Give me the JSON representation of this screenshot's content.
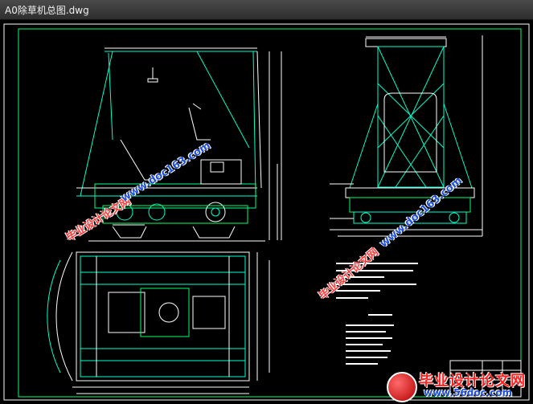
{
  "window": {
    "title": "A0除草机总图.dwg"
  },
  "watermarks": [
    {
      "text": "毕业设计论文网",
      "color": "red"
    },
    {
      "text": "www.doc163.com",
      "color": "blue"
    },
    {
      "text": "毕业设计论文网",
      "color": "red"
    },
    {
      "text": "www.doc163.com",
      "color": "blue"
    }
  ],
  "brand": {
    "name": "毕业设计论文网",
    "url": "www.56doc.com"
  },
  "colors": {
    "background": "#000000",
    "frame": "#ffffff",
    "geometry": "#00ffff",
    "accent": "#00ff66",
    "titlebar": "#3a3a3a"
  },
  "icons": [
    "brand-logo-icon"
  ]
}
